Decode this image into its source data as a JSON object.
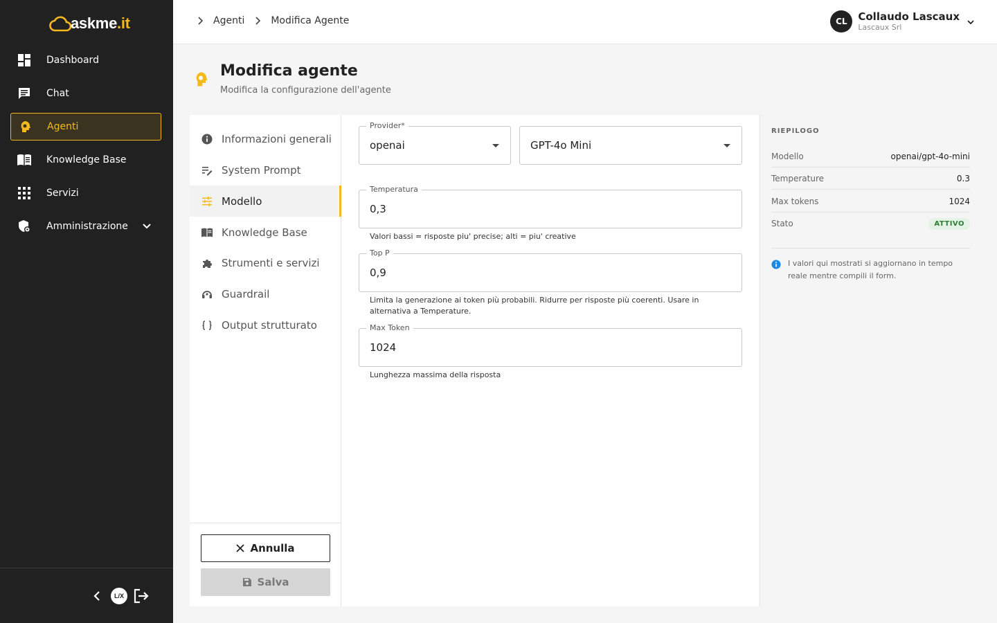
{
  "brand": {
    "logo_text": "askme",
    "logo_suffix": ".it"
  },
  "sidebar": {
    "items": [
      {
        "label": "Dashboard",
        "icon": "dashboard-icon"
      },
      {
        "label": "Chat",
        "icon": "chat-icon"
      },
      {
        "label": "Agenti",
        "icon": "agent-head-icon",
        "active": true
      },
      {
        "label": "Knowledge Base",
        "icon": "book-icon"
      },
      {
        "label": "Servizi",
        "icon": "grid-icon"
      },
      {
        "label": "Amministrazione",
        "icon": "admin-shield-icon",
        "expandable": true
      }
    ],
    "footer": {
      "brand_badge": "L/X"
    }
  },
  "header": {
    "breadcrumbs": [
      "Agenti",
      "Modifica Agente"
    ],
    "user": {
      "initials": "CL",
      "name": "Collaudo Lascaux",
      "org": "Lascaux Srl"
    }
  },
  "page": {
    "title": "Modifica agente",
    "subtitle": "Modifica la configurazione dell'agente"
  },
  "tabs": [
    {
      "label": "Informazioni generali",
      "icon": "info-icon"
    },
    {
      "label": "System Prompt",
      "icon": "edit-lines-icon"
    },
    {
      "label": "Modello",
      "icon": "sliders-icon",
      "active": true
    },
    {
      "label": "Knowledge Base",
      "icon": "book-icon"
    },
    {
      "label": "Strumenti e servizi",
      "icon": "puzzle-icon"
    },
    {
      "label": "Guardrail",
      "icon": "headset-icon"
    },
    {
      "label": "Output strutturato",
      "icon": "braces-icon"
    }
  ],
  "actions": {
    "cancel_label": "Annulla",
    "save_label": "Salva"
  },
  "form": {
    "provider": {
      "label": "Provider*",
      "value": "openai"
    },
    "model": {
      "value": "GPT-4o Mini"
    },
    "temperature": {
      "label": "Temperatura",
      "value": "0,3",
      "helper": "Valori bassi = risposte piu' precise; alti = piu' creative"
    },
    "top_p": {
      "label": "Top P",
      "value": "0,9",
      "helper_line1": "Limita la generazione ai token più probabili. Ridurre per risposte più coerenti. Usare in",
      "helper_line2": "alternativa a Temperature."
    },
    "max_token": {
      "label": "Max Token",
      "value": "1024",
      "helper": "Lunghezza massima della risposta"
    }
  },
  "summary": {
    "title": "RIEPILOGO",
    "rows": [
      {
        "key": "Modello",
        "value": "openai/gpt-4o-mini"
      },
      {
        "key": "Temperature",
        "value": "0.3"
      },
      {
        "key": "Max tokens",
        "value": "1024"
      },
      {
        "key": "Stato",
        "value": "ATTIVO"
      }
    ],
    "info": "I valori qui mostrati si aggiornano in tempo reale mentre compili il form."
  },
  "colors": {
    "accent": "#f5b91e",
    "sidebar_bg": "#212121",
    "status_active": "#2e7d32"
  }
}
